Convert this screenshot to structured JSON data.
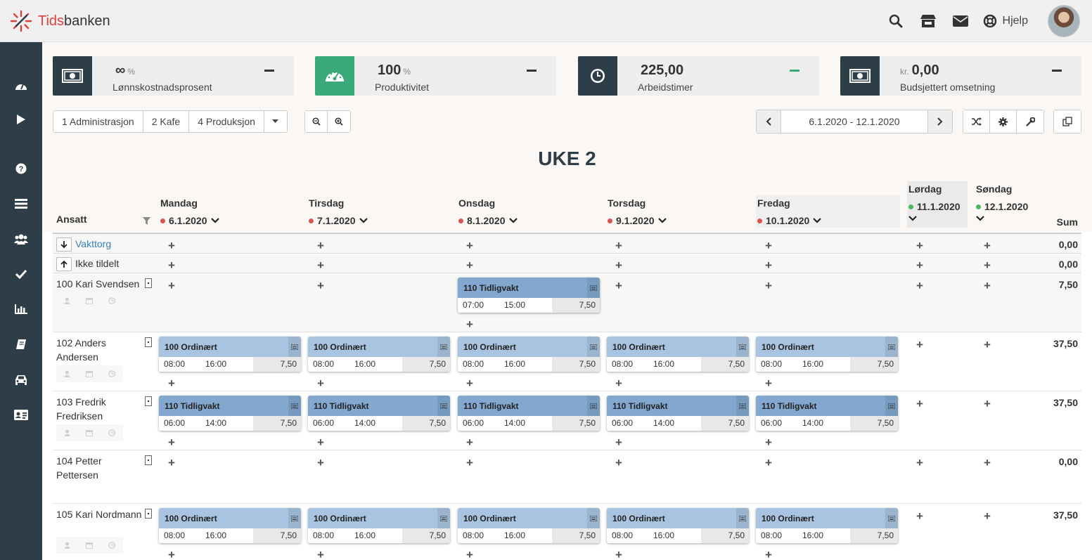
{
  "app": {
    "logo_prefix": "Tids",
    "logo_suffix": "banken",
    "help_label": "Hjelp"
  },
  "colors": {
    "sidebar": "#2d3e48",
    "green": "#3aaa7a",
    "red": "#d9534f",
    "dot_green": "#4cb860",
    "shift_ordinar": "#a9c4e0",
    "shift_tidlig": "#82a8d0"
  },
  "kpis": [
    {
      "icon": "money-icon",
      "value": "∞",
      "unit": "%",
      "prefix": "",
      "label": "Lønnskostnadsprosent"
    },
    {
      "icon": "speedometer-icon",
      "value": "100",
      "unit": "%",
      "prefix": "",
      "label": "Produktivitet"
    },
    {
      "icon": "clock-icon",
      "value": "225,00",
      "unit": "",
      "prefix": "",
      "label": "Arbeidstimer"
    },
    {
      "icon": "money-icon",
      "value": "0,00",
      "unit": "",
      "prefix": "kr.",
      "label": "Budsjettert omsetning"
    }
  ],
  "departments": [
    "1 Administrasjon",
    "2 Kafe",
    "4 Produksjon"
  ],
  "date_range": "6.1.2020 - 12.1.2020",
  "week_title": "UKE 2",
  "table": {
    "employee_header": "Ansatt",
    "sum_header": "Sum",
    "days": [
      {
        "name": "Mandag",
        "date": "6.1.2020"
      },
      {
        "name": "Tirsdag",
        "date": "7.1.2020"
      },
      {
        "name": "Onsdag",
        "date": "8.1.2020"
      },
      {
        "name": "Torsdag",
        "date": "9.1.2020"
      },
      {
        "name": "Fredag",
        "date": "10.1.2020"
      },
      {
        "name": "Lørdag",
        "date": "11.1.2020"
      },
      {
        "name": "Søndag",
        "date": "12.1.2020"
      }
    ],
    "special_rows": [
      {
        "label": "Vakttorg",
        "sum": "0,00"
      },
      {
        "label": "Ikke tildelt",
        "sum": "0,00"
      }
    ],
    "employees": [
      {
        "name": "100 Kari Svendsen",
        "sum": "7,50"
      },
      {
        "name": "102 Anders Andersen",
        "sum": "37,50"
      },
      {
        "name": "103 Fredrik Fredriksen",
        "sum": "37,50"
      },
      {
        "name": "104 Petter Pettersen",
        "sum": "0,00"
      },
      {
        "name": "105 Kari Nordmann",
        "sum": "37,50"
      }
    ],
    "shift_types": {
      "ordinar": {
        "title": "100 Ordinært",
        "start": "08:00",
        "end": "16:00",
        "hours": "7,50"
      },
      "tidlig_a": {
        "title": "110 Tidligvakt",
        "start": "07:00",
        "end": "15:00",
        "hours": "7,50"
      },
      "tidlig_b": {
        "title": "110 Tidligvakt",
        "start": "06:00",
        "end": "14:00",
        "hours": "7,50"
      }
    }
  }
}
